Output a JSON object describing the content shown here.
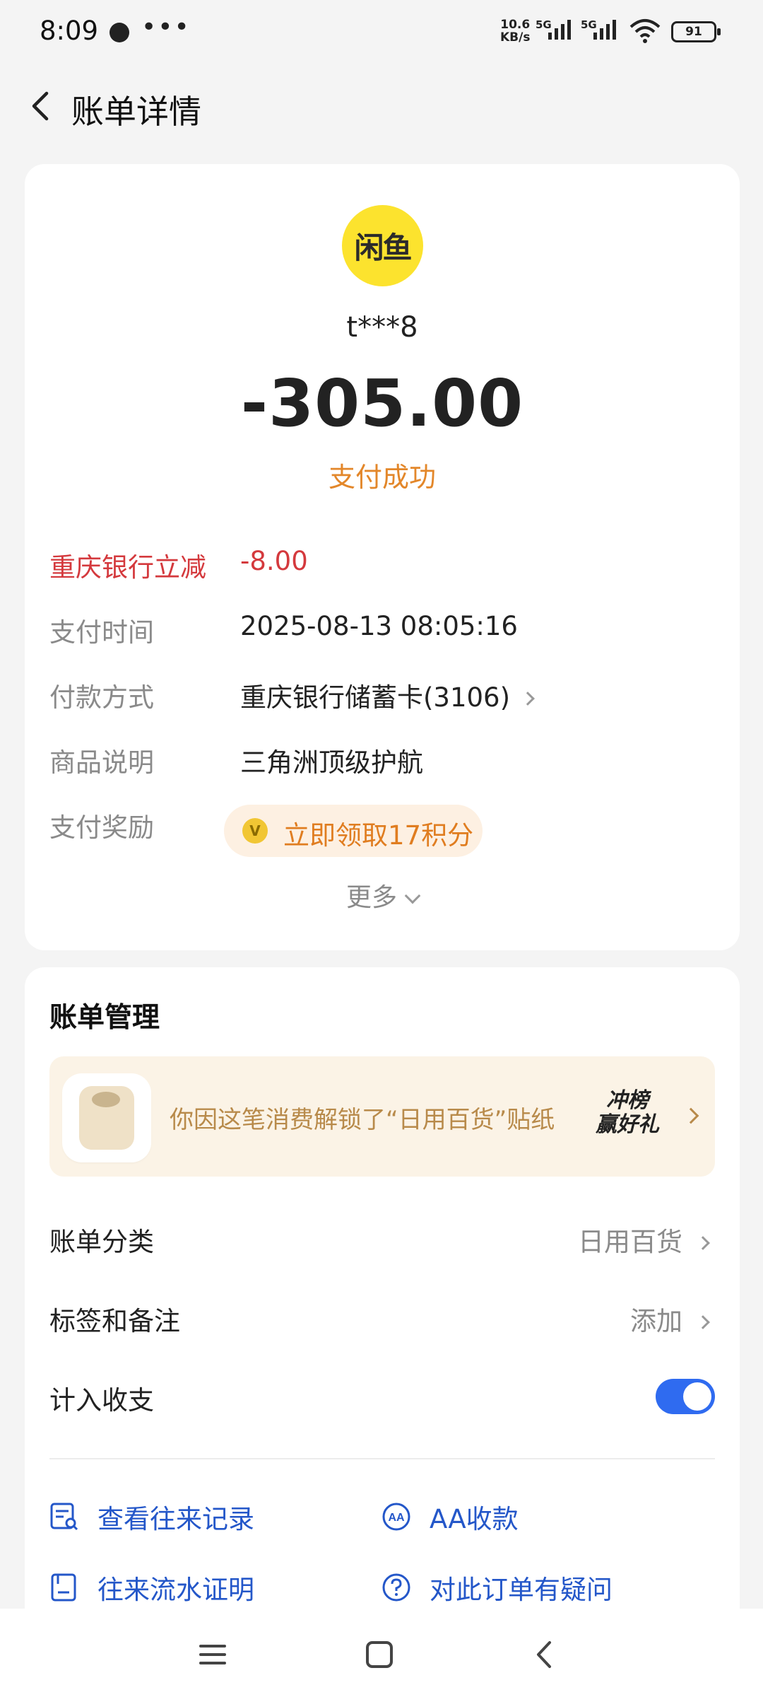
{
  "status_bar": {
    "time": "8:09",
    "more": "•••",
    "net_speed_value": "10.6",
    "net_speed_unit": "KB/s",
    "sim1_label": "5G",
    "sim2_label": "5G",
    "battery": "91"
  },
  "header": {
    "title": "账单详情"
  },
  "summary": {
    "merchant_logo_text": "闲鱼",
    "merchant_name": "t***8",
    "amount": "-305.00",
    "status": "支付成功",
    "status_color": "#e3872a"
  },
  "details": {
    "discount_label": "重庆银行立减",
    "discount_value": "-8.00",
    "time_label": "支付时间",
    "time_value": "2025-08-13 08:05:16",
    "method_label": "付款方式",
    "method_value": "重庆银行储蓄卡(3106)",
    "desc_label": "商品说明",
    "desc_value": "三角洲顶级护航",
    "reward_label": "支付奖励",
    "reward_value": "立即领取17积分",
    "reward_coin": "V",
    "more_label": "更多"
  },
  "management": {
    "title": "账单管理",
    "banner_text": "你因这笔消费解锁了“日用百货”贴纸",
    "banner_badge_line1": "冲榜",
    "banner_badge_line2": "赢好礼",
    "category_label": "账单分类",
    "category_value": "日用百货",
    "tag_label": "标签和备注",
    "tag_value": "添加",
    "include_label": "计入收支",
    "include_on": true
  },
  "actions": {
    "view_records": "查看往来记录",
    "aa_collect": "AA收款",
    "proof": "往来流水证明",
    "question": "对此订单有疑问"
  },
  "colors": {
    "accent_blue": "#2f6bf0",
    "link_blue": "#2457c9",
    "discount_red": "#d4393d",
    "logo_yellow": "#fce32e"
  }
}
